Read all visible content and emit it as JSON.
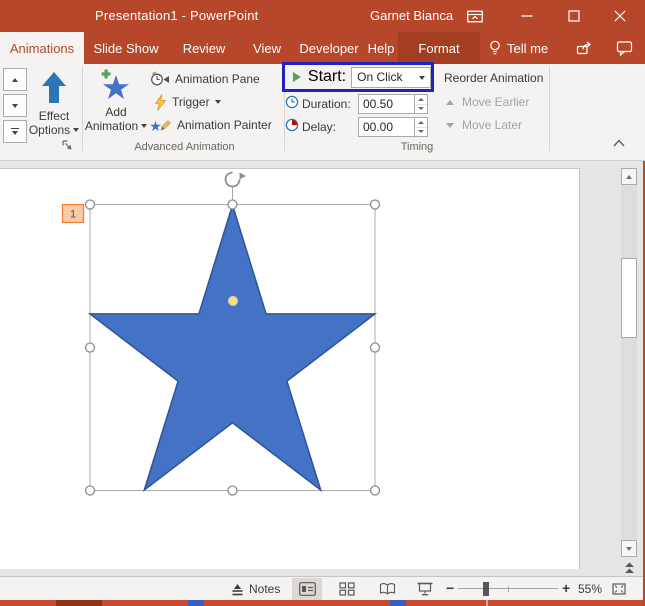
{
  "window": {
    "title": "Presentation1 - PowerPoint",
    "user_name": "Garnet Bianca"
  },
  "tabs": [
    {
      "label": "Animations"
    },
    {
      "label": "Slide Show"
    },
    {
      "label": "Review"
    },
    {
      "label": "View"
    },
    {
      "label": "Developer"
    },
    {
      "label": "Help"
    },
    {
      "label": "Format"
    }
  ],
  "tell_me": {
    "label": "Tell me"
  },
  "ribbon": {
    "effect_options": {
      "line1": "Effect",
      "line2": "Options"
    },
    "add_animation": {
      "line1": "Add",
      "line2": "Animation"
    },
    "advanced_animation": {
      "animation_pane": "Animation Pane",
      "trigger": "Trigger",
      "animation_painter": "Animation Painter",
      "group_label": "Advanced Animation"
    },
    "timing": {
      "start_label": "Start:",
      "start_value": "On Click",
      "duration_label": "Duration:",
      "duration_value": "00.50",
      "delay_label": "Delay:",
      "delay_value": "00.00",
      "reorder_label": "Reorder Animation",
      "move_earlier": "Move Earlier",
      "move_later": "Move Later",
      "group_label": "Timing"
    }
  },
  "slide": {
    "animation_badge": "1"
  },
  "status_bar": {
    "notes_label": "Notes",
    "zoom_percent": "55%"
  },
  "colors": {
    "titlebar_bg": "#B7472A",
    "format_tab_bg": "#A33E22",
    "selected_tab_text": "#B7472A",
    "ribbon_bg": "#F4F3F1",
    "workspace_bg": "#E7E6E6",
    "highlight_box": "#2222C2",
    "star_fill": "#4472C4",
    "star_stroke": "#2F5597",
    "badge_bg": "#F7CBA8",
    "badge_border": "#ED7D31",
    "play_green": "#54A254",
    "icon_blue": "#2E75B6",
    "bolt_yellow": "#FFC335",
    "delay_red": "#C00000",
    "statusbar_bg": "#F4F3F1",
    "taskbar_orange": "#C84A31"
  }
}
